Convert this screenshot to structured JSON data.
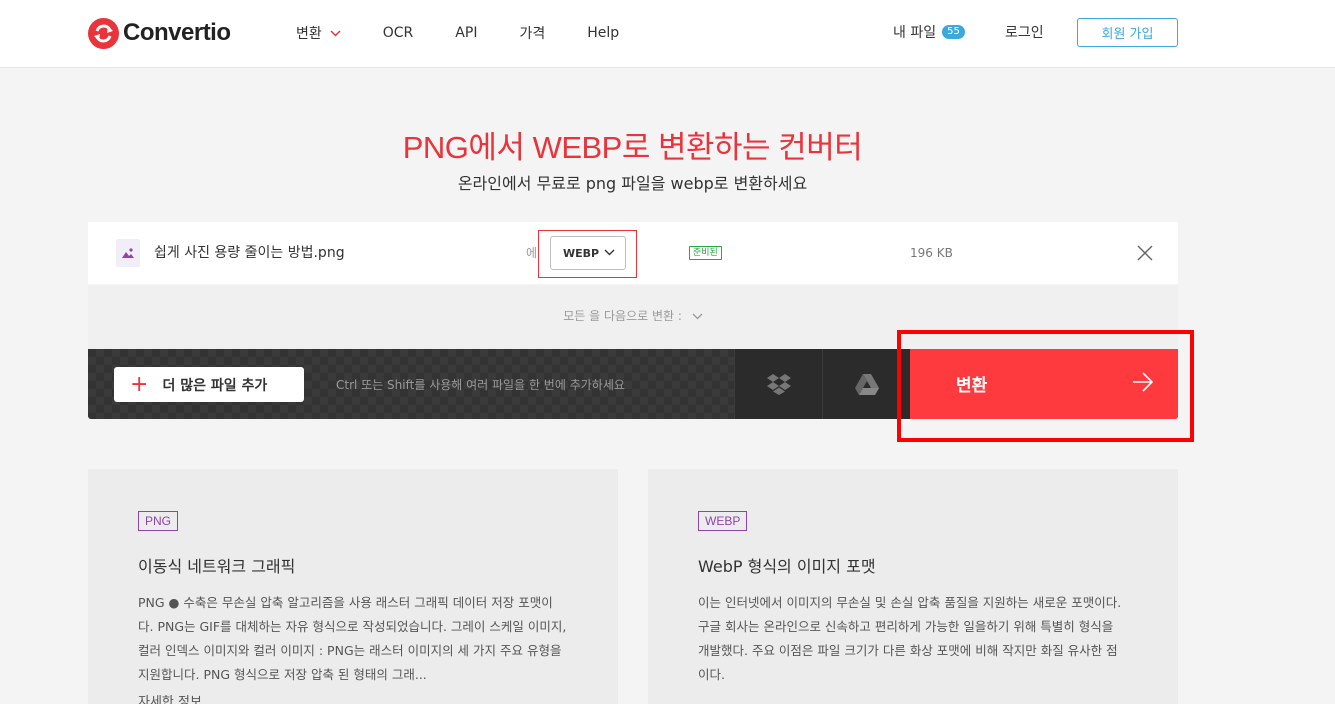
{
  "header": {
    "logo_text": "Convertio",
    "nav": [
      "변환",
      "OCR",
      "API",
      "가격",
      "Help"
    ],
    "my_files_label": "내 파일",
    "my_files_count": "55",
    "login_label": "로그인",
    "signup_label": "회원 가입"
  },
  "hero": {
    "title": "PNG에서 WEBP로 변환하는 컨버터",
    "subtitle": "온라인에서 무료로 png 파일을 webp로 변환하세요"
  },
  "file": {
    "name": "쉽게 사진 용량 줄이는 방법.png",
    "to_label": "에",
    "target_format": "WEBP",
    "status": "준비된",
    "size": "196 KB"
  },
  "convert_all": {
    "label": "모든 을 다음으로 변환 :"
  },
  "action_bar": {
    "add_more_label": "더 많은 파일 추가",
    "hint": "Ctrl 또는 Shift를 사용해 여러 파일을 한 번에 추가하세요",
    "dropbox_icon": "dropbox-icon",
    "gdrive_icon": "google-drive-icon",
    "convert_label": "변환"
  },
  "cards": [
    {
      "tag": "PNG",
      "title": "이동식 네트워크 그래픽",
      "body": "PNG ● 수축은 무손실 압축 알고리즘을 사용 래스터 그래픽 데이터 저장 포맷이다. PNG는 GIF를 대체하는 자유 형식으로 작성되었습니다. 그레이 스케일 이미지, 컬러 인덱스 이미지와 컬러 이미지 : PNG는 래스터 이미지의 세 가지 주요 유형을 지원합니다. PNG 형식으로 저장 압축 된 형태의 그래...",
      "more": "자세한 정보"
    },
    {
      "tag": "WEBP",
      "title": "WebP 형식의 이미지 포맷",
      "body": "이는 인터넷에서 이미지의 무손실 및 손실 압축 품질을 지원하는 새로운 포맷이다. 구글 회사는 온라인으로 신속하고 편리하게 가능한 일을하기 위해 특별히 형식을 개발했다. 주요 이점은 파일 크기가 다른 화상 포맷에 비해 작지만 화질 유사한 점이다.",
      "more": ""
    }
  ],
  "colors": {
    "brand": "#e8343a",
    "convert_button": "#ff3a3f",
    "accent_blue": "#3aa9db",
    "tag_purple": "#8e44ad",
    "status_green": "#27a844",
    "highlight": "#ff0000"
  }
}
